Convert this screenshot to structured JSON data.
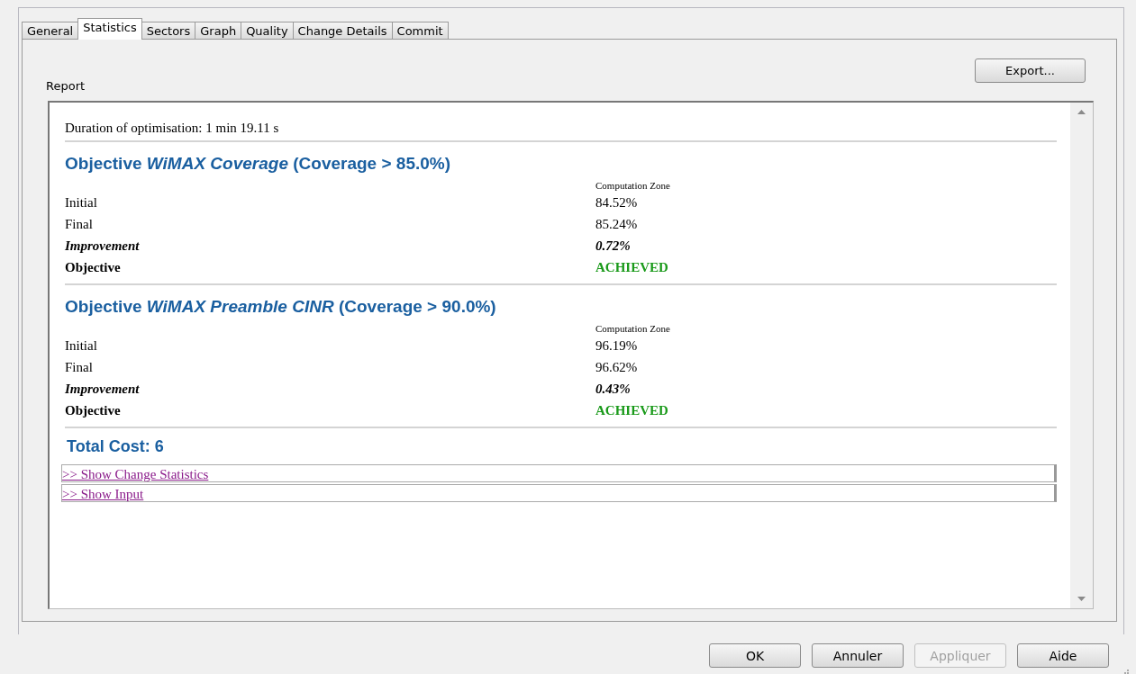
{
  "tabs": [
    {
      "label": "General",
      "selected": false
    },
    {
      "label": "Statistics",
      "selected": true
    },
    {
      "label": "Sectors",
      "selected": false
    },
    {
      "label": "Graph",
      "selected": false
    },
    {
      "label": "Quality",
      "selected": false
    },
    {
      "label": "Change Details",
      "selected": false
    },
    {
      "label": "Commit",
      "selected": false
    }
  ],
  "report_label": "Report",
  "export_button": "Export...",
  "report": {
    "duration": "Duration of optimisation: 1 min 19.11 s",
    "objectives": [
      {
        "title": "Objective *WiMAX Coverage* (Coverage > 85.0%)",
        "column_header": "Computation Zone",
        "rows": [
          {
            "kind": "value",
            "label": "Initial",
            "value": "84.52%"
          },
          {
            "kind": "value",
            "label": "Final",
            "value": "85.24%"
          },
          {
            "kind": "improvement",
            "label": "Improvement",
            "value": "0.72%"
          },
          {
            "kind": "status",
            "label": "Objective",
            "value": "ACHIEVED"
          }
        ]
      },
      {
        "title": "Objective *WiMAX Preamble CINR* (Coverage > 90.0%)",
        "column_header": "Computation Zone",
        "rows": [
          {
            "kind": "value",
            "label": "Initial",
            "value": "96.19%"
          },
          {
            "kind": "value",
            "label": "Final",
            "value": "96.62%"
          },
          {
            "kind": "improvement",
            "label": "Improvement",
            "value": "0.43%"
          },
          {
            "kind": "status",
            "label": "Objective",
            "value": "ACHIEVED"
          }
        ]
      }
    ],
    "total_cost": "Total Cost: 6",
    "links": [
      ">> Show Change Statistics",
      ">> Show Input"
    ]
  },
  "buttons": [
    {
      "label": "OK",
      "disabled": false
    },
    {
      "label": "Annuler",
      "disabled": false
    },
    {
      "label": "Appliquer",
      "disabled": true
    },
    {
      "label": "Aide",
      "disabled": false
    }
  ]
}
